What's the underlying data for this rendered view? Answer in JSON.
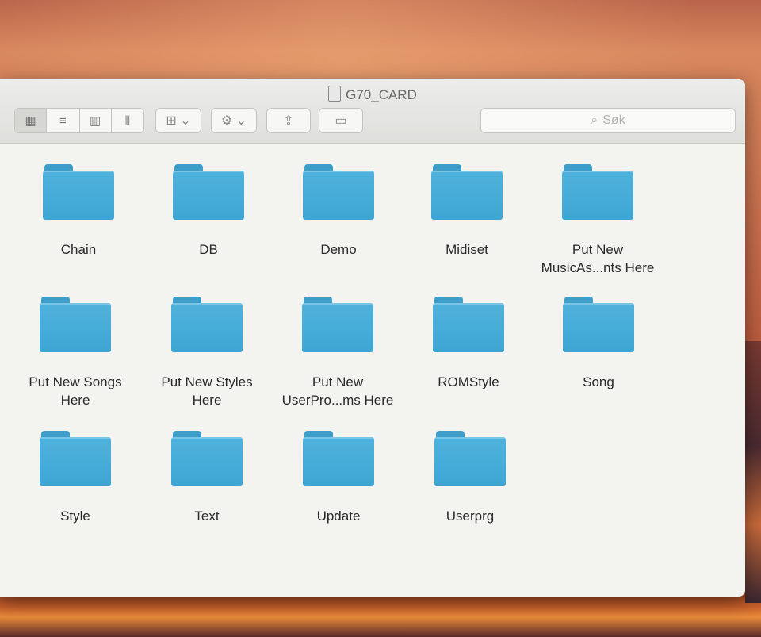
{
  "window": {
    "title": "G70_CARD"
  },
  "toolbar": {
    "view_buttons": [
      {
        "name": "icon-view",
        "icon": "▦",
        "active": true
      },
      {
        "name": "list-view",
        "icon": "≡",
        "active": false
      },
      {
        "name": "column-view",
        "icon": "▥",
        "active": false
      },
      {
        "name": "gallery-view",
        "icon": "⫴",
        "active": false
      }
    ],
    "arrange_icon": "⊞ ⌄",
    "action_icon": "⚙ ⌄",
    "share_icon": "⇪",
    "tag_icon": "▭",
    "search_icon": "⌕",
    "search_placeholder": "Søk"
  },
  "folders": [
    {
      "label": "Chain"
    },
    {
      "label": "DB"
    },
    {
      "label": "Demo"
    },
    {
      "label": "Midiset"
    },
    {
      "label": "Put New MusicAs...nts Here"
    },
    {
      "label": "Put New Songs Here"
    },
    {
      "label": "Put New Styles Here"
    },
    {
      "label": "Put New UserPro...ms Here"
    },
    {
      "label": "ROMStyle"
    },
    {
      "label": "Song"
    },
    {
      "label": "Style"
    },
    {
      "label": "Text"
    },
    {
      "label": "Update"
    },
    {
      "label": "Userprg"
    }
  ],
  "colors": {
    "folder": "#3ea6d4",
    "window_bg": "#f3f3ef"
  }
}
